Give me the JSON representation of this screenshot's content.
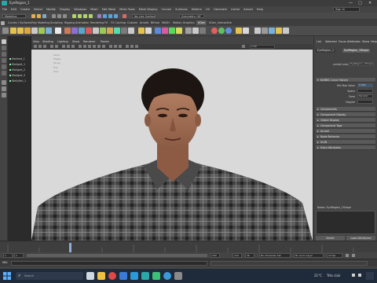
{
  "window": {
    "title": "EyeRegion_1",
    "min": "—",
    "max": "▢",
    "close": "✕"
  },
  "menu": {
    "items": [
      "File",
      "Edit",
      "Create",
      "Select",
      "Modify",
      "Display",
      "Windows",
      "Mesh",
      "Edit Mesh",
      "Mesh Tools",
      "Mesh Display",
      "Curves",
      "Surfaces",
      "Deform",
      "UV",
      "Generate",
      "Cache",
      "Arnold",
      "Help"
    ],
    "signin": "Sign In"
  },
  "statusline": {
    "mode_dropdown": "Modeling",
    "live_surface": "No Live Surface",
    "symmetry": "Symmetry: Off"
  },
  "shelf_tabs": [
    "Curves / Surfaces",
    "Poly Modeling",
    "Sculpting",
    "Rigging",
    "Animation",
    "Rendering",
    "FX",
    "FX Caching",
    "Custom",
    "Arnold",
    "Bifrost",
    "MASH",
    "Motion Graphics",
    "XGen",
    "XGen_Interactive"
  ],
  "shelf_tab_active": "XGen",
  "outliner": {
    "items": [
      "Marlked_1",
      "Marlged_1",
      "Marlged_2",
      "Marlged_3",
      "Wellyfbrl_1"
    ]
  },
  "viewport": {
    "menu": [
      "View",
      "Shading",
      "Lighting",
      "Show",
      "Renderer",
      "Panels"
    ],
    "camera_field": "0.00",
    "hud": [
      "Verts:",
      "Edges:",
      "Faces:",
      "Tris:",
      "UVs:"
    ]
  },
  "attr_editor": {
    "tabs": [
      "List",
      "Selected",
      "Focus",
      "Attributes",
      "Show",
      "Help"
    ],
    "node_tabs": [
      "EyeRegion_1",
      "EyeRegion_1Shape"
    ],
    "node_label": "nurbsCurve:",
    "node_value": "EyeRegion_1Shape",
    "sections": [
      {
        "label": "NURBS Curve History",
        "open": true
      },
      {
        "label": "Components",
        "open": false
      },
      {
        "label": "Component Display",
        "open": false
      },
      {
        "label": "Object Display",
        "open": false
      },
      {
        "label": "Component Tags",
        "open": false
      },
      {
        "label": "Arnold",
        "open": false
      },
      {
        "label": "Node Behavior",
        "open": false
      },
      {
        "label": "UUID",
        "open": false
      },
      {
        "label": "Extra Attributes",
        "open": false
      }
    ],
    "fields": [
      {
        "label": "Min Max Value",
        "value": "0.000"
      },
      {
        "label": "Spans",
        "value": ""
      },
      {
        "label": "Form",
        "value": "Periodic"
      },
      {
        "label": "Degree",
        "value": ""
      }
    ],
    "notes_label": "Notes: EyeRegion_1Shape",
    "select_button": "Select",
    "load_button": "Load Attributes"
  },
  "timeline": {
    "start": "1",
    "end": "120",
    "range_start": "1",
    "range_end": "200",
    "current": "30",
    "character_set": "No Character Set",
    "anim_layer": "No Anim Layer",
    "fps": "24 fps"
  },
  "cmdline": {
    "label": "MEL"
  },
  "taskbar": {
    "search_placeholder": "Search",
    "temperature": "21°C",
    "weather": "Très clair",
    "apps": [
      "file-explorer",
      "chrome",
      "store",
      "mail",
      "maya",
      "photos",
      "edge",
      "settings",
      "terminal"
    ]
  }
}
